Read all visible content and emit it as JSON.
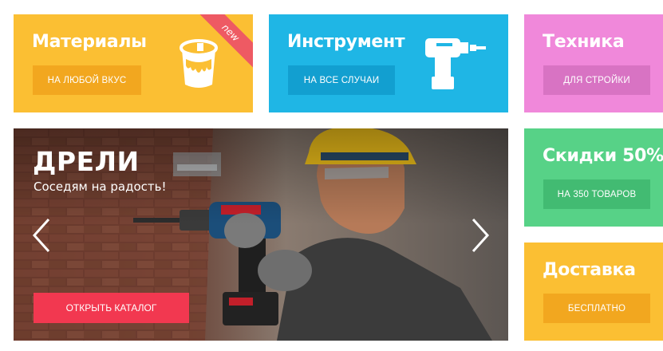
{
  "tiles": {
    "materials": {
      "title": "Материалы",
      "button": "На любой вкус",
      "badge": "new",
      "icon": "paint-bucket-icon",
      "color": "#fbbf33"
    },
    "tools": {
      "title": "Инструмент",
      "button": "На все случаи",
      "icon": "drill-icon",
      "color": "#1fb6e5"
    },
    "tech": {
      "title": "Техника",
      "button": "Для стройки",
      "color": "#f088da"
    },
    "sale": {
      "title": "Скидки 50%",
      "button": "На 350 товаров",
      "color": "#57d287"
    },
    "delivery": {
      "title": "Доставка",
      "button": "Бесплатно",
      "color": "#fbbf33"
    }
  },
  "hero": {
    "title": "ДРЕЛИ",
    "subtitle": "Соседям на радость!",
    "button": "Открыть каталог",
    "accent": "#f23850"
  }
}
